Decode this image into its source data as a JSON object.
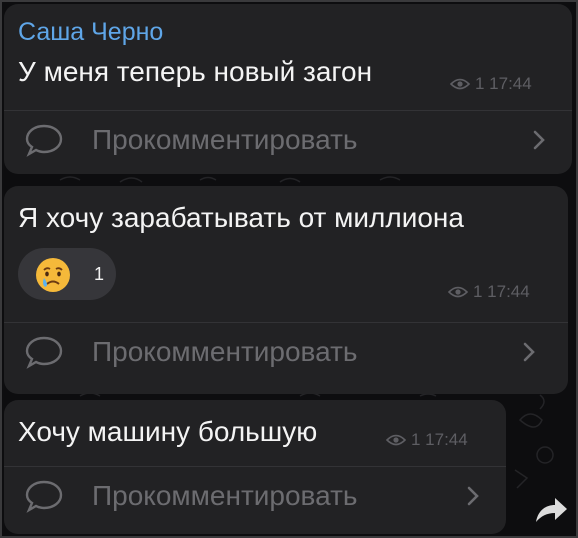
{
  "messages": [
    {
      "author": "Саша Черно",
      "text": "У меня теперь новый загон",
      "views": "1 17:44",
      "comment_label": "Прокомментировать"
    },
    {
      "text": "Я хочу зарабатывать от миллиона",
      "reaction": {
        "emoji": "crying-face-emoji",
        "count": "1"
      },
      "views": "1 17:44",
      "comment_label": "Прокомментировать"
    },
    {
      "text": "Хочу машину большую",
      "views": "1 17:44",
      "comment_label": "Прокомментировать"
    }
  ],
  "icons": {
    "views": "eye-icon",
    "comment": "comment-bubble-icon",
    "chevron": "chevron-right-icon",
    "share": "share-arrow-icon"
  },
  "colors": {
    "background": "#0d0d0f",
    "bubble": "#222224",
    "author": "#5fa6e8",
    "text": "#f4f4f4",
    "meta": "#5e5e63",
    "comment_label": "#6c6c70",
    "reaction_pill": "#36363a"
  }
}
